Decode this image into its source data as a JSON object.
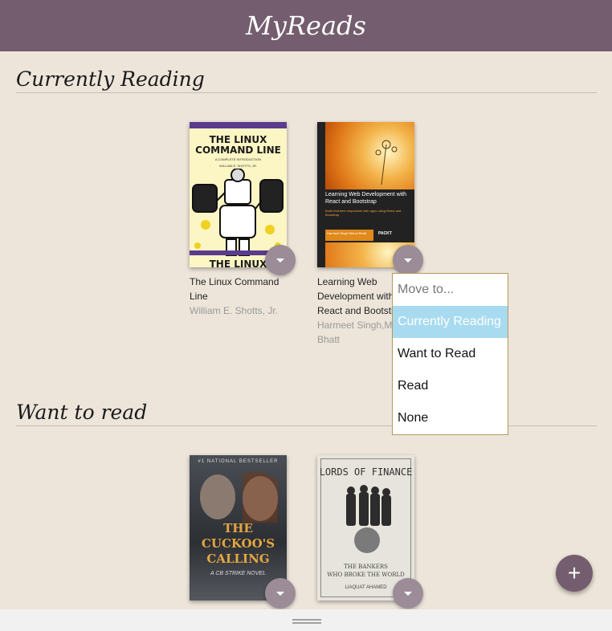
{
  "app": {
    "title": "MyReads"
  },
  "shelves": [
    {
      "title": "Currently Reading",
      "books": [
        {
          "title": "The Linux Command Line",
          "authors": "William E. Shotts, Jr.",
          "cover": {
            "line1": "THE LINUX",
            "line2": "COMMAND LINE",
            "subtitle": "A COMPLETE INTRODUCTION",
            "author": "WILLIAM E. SHOTTS, JR.",
            "bottom": "THE LINUX"
          }
        },
        {
          "title": "Learning Web Development with React and Bootstrap",
          "authors": "Harmeet Singh,Mehul Bhatt",
          "cover": {
            "title": "Learning Web Development with React and Bootstrap",
            "subtitle": "Build real-time responsive web apps using React and Bootstrap",
            "authors": "Harmeet Singh Mehul Bhatt",
            "brand": "PACKT"
          }
        }
      ]
    },
    {
      "title": "Want to read",
      "books": [
        {
          "cover": {
            "top": "#1 NATIONAL BESTSELLER",
            "line1": "THE",
            "line2": "CUCKOO'S",
            "line3": "CALLING",
            "subtitle": "A CB STRIKE NOVEL"
          }
        },
        {
          "cover": {
            "title": "LORDS OF FINANCE",
            "line1": "THE BANKERS",
            "line2": "WHO BROKE THE WORLD",
            "author": "LIAQUAT AHAMED"
          }
        }
      ]
    }
  ],
  "move_menu": {
    "header": "Move to...",
    "options": [
      "Currently Reading",
      "Want to Read",
      "Read",
      "None"
    ],
    "selected": "Currently Reading"
  },
  "fab": {
    "label": "+"
  },
  "colors": {
    "header": "#735d6e",
    "background": "#ede5da",
    "selected_option": "#a8dbf0",
    "menu_button": "#9c8c98"
  }
}
